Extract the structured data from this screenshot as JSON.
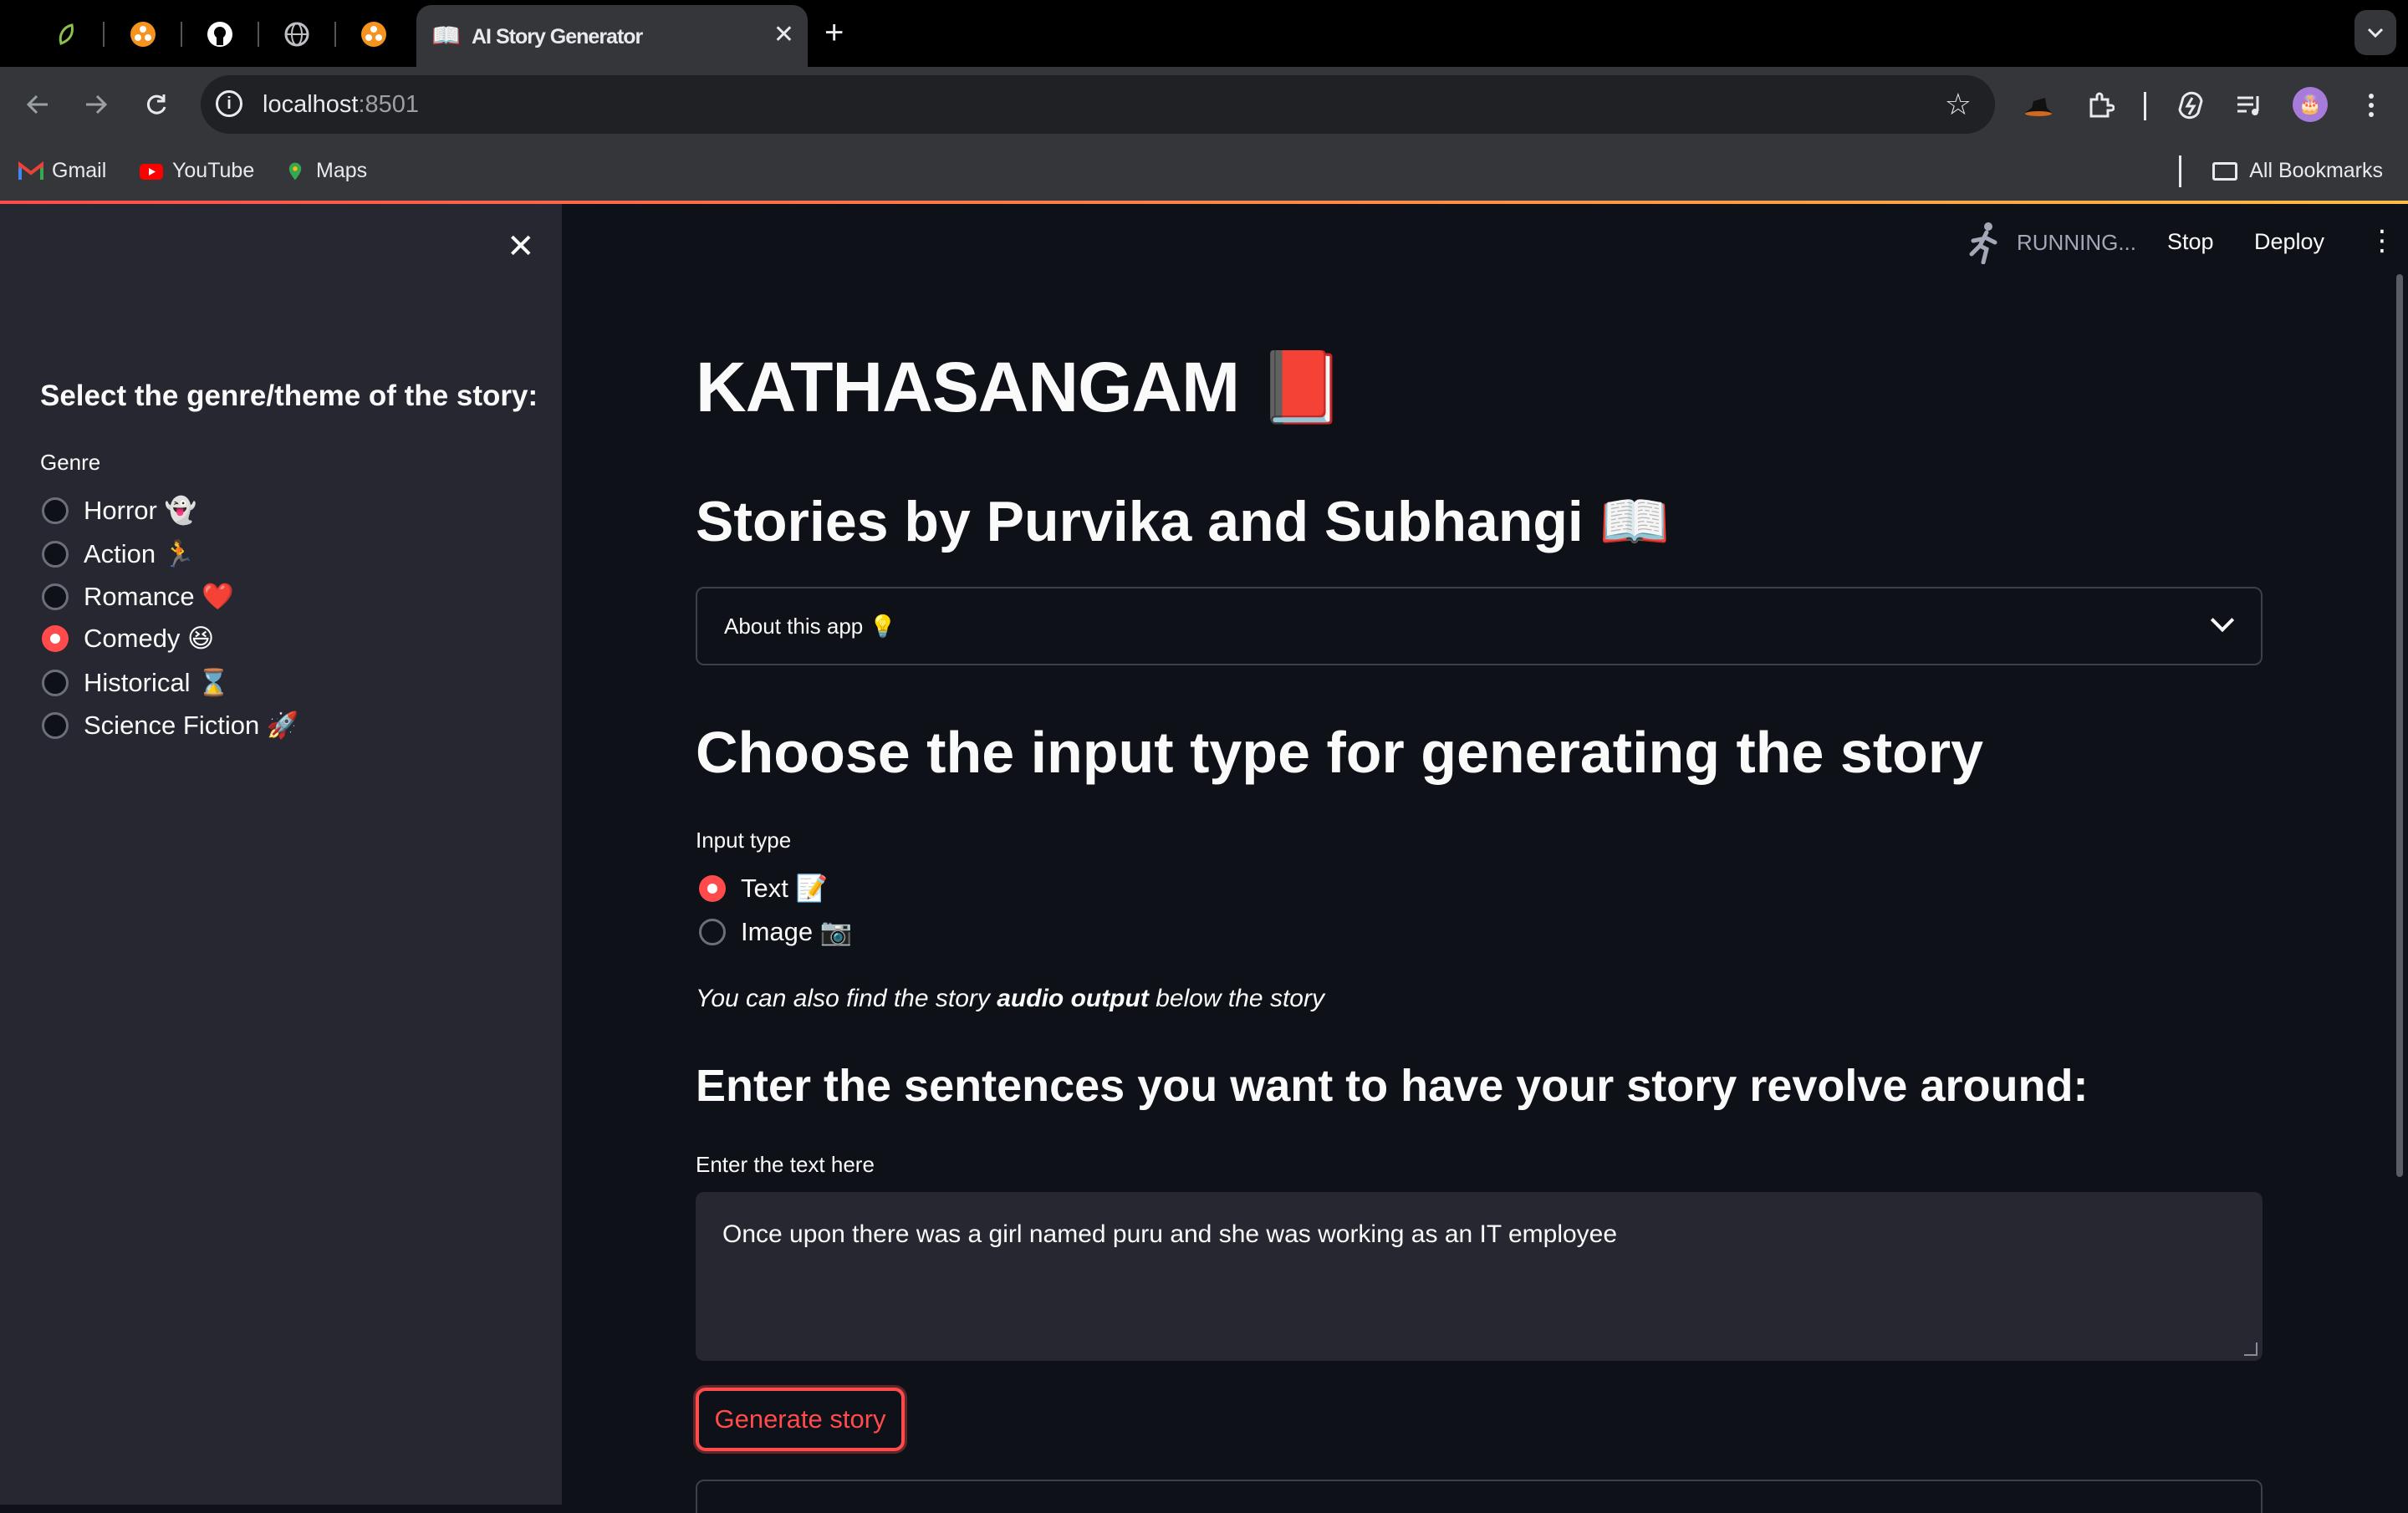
{
  "browser": {
    "tab_title": "AI Story Generator",
    "tab_favicon": "📖",
    "new_tab_symbol": "+",
    "close_symbol": "✕",
    "url_host": "localhost",
    "url_port": ":8501",
    "bookmarks": [
      {
        "label": "Gmail"
      },
      {
        "label": "YouTube"
      },
      {
        "label": "Maps"
      }
    ],
    "all_bookmarks": "All Bookmarks"
  },
  "header": {
    "status": "RUNNING...",
    "stop": "Stop",
    "deploy": "Deploy"
  },
  "sidebar": {
    "heading": "Select the genre/theme of the story:",
    "genre_label": "Genre",
    "genres": [
      {
        "label": "Horror 👻",
        "selected": false
      },
      {
        "label": "Action 🏃",
        "selected": false
      },
      {
        "label": "Romance ❤️",
        "selected": false
      },
      {
        "label": "Comedy 😆",
        "selected": true
      },
      {
        "label": "Historical ⌛",
        "selected": false
      },
      {
        "label": "Science Fiction 🚀",
        "selected": false
      }
    ]
  },
  "main": {
    "title": "KATHASANGAM 📕",
    "subtitle": "Stories by Purvika and Subhangi 📖",
    "about_expander": "About this app 💡",
    "choose_heading": "Choose the input type for generating the story",
    "input_type_label": "Input type",
    "input_types": [
      {
        "label": "Text 📝",
        "selected": true
      },
      {
        "label": "Image 📷",
        "selected": false
      }
    ],
    "hint_pre": "You can also find the story ",
    "hint_bold": "audio output",
    "hint_post": " below the story",
    "enter_heading": "Enter the sentences you want to have your story revolve around:",
    "text_label": "Enter the text here",
    "text_value": "Once upon there was a girl named puru and she was working as an IT employee",
    "generate_button": "Generate story"
  },
  "colors": {
    "accent": "#ff4b4b",
    "background": "#0e1117",
    "sidebar": "#262730"
  }
}
